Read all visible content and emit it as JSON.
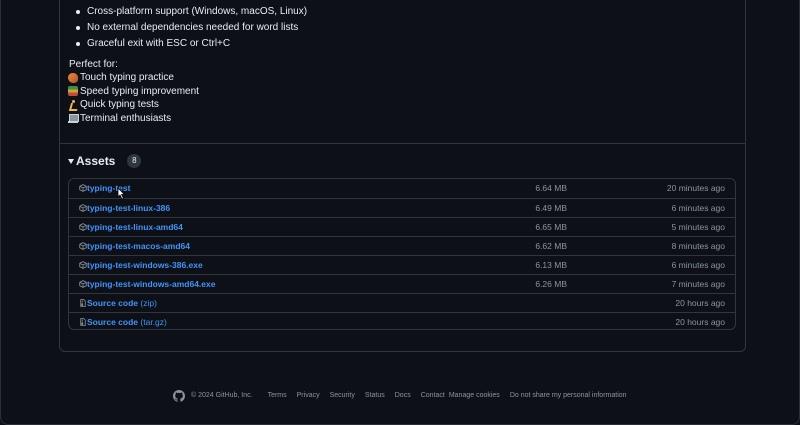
{
  "release": {
    "features": [
      "Cross-platform support (Windows, macOS, Linux)",
      "No external dependencies needed for word lists",
      "Graceful exit with ESC or Ctrl+C"
    ],
    "perfect_for_title": "Perfect for:",
    "perfect_for": [
      {
        "icon": "guitar-icon",
        "label": "Touch typing practice"
      },
      {
        "icon": "books-icon",
        "label": "Speed typing improvement"
      },
      {
        "icon": "runner-icon",
        "label": "Quick typing tests"
      },
      {
        "icon": "laptop-icon",
        "label": "Terminal enthusiasts"
      }
    ]
  },
  "assets": {
    "title": "Assets",
    "count": "8",
    "items": [
      {
        "name": "typing-test",
        "suffix": "",
        "size": "6.64 MB",
        "time": "20 minutes ago",
        "icon": "package-icon"
      },
      {
        "name": "typing-test-linux-386",
        "suffix": "",
        "size": "6.49 MB",
        "time": "6 minutes ago",
        "icon": "package-icon"
      },
      {
        "name": "typing-test-linux-amd64",
        "suffix": "",
        "size": "6.65 MB",
        "time": "5 minutes ago",
        "icon": "package-icon"
      },
      {
        "name": "typing-test-macos-amd64",
        "suffix": "",
        "size": "6.62 MB",
        "time": "8 minutes ago",
        "icon": "package-icon"
      },
      {
        "name": "typing-test-windows-386.exe",
        "suffix": "",
        "size": "6.13 MB",
        "time": "6 minutes ago",
        "icon": "package-icon"
      },
      {
        "name": "typing-test-windows-amd64.exe",
        "suffix": "",
        "size": "6.26 MB",
        "time": "7 minutes ago",
        "icon": "package-icon"
      },
      {
        "name": "Source code",
        "suffix": "(zip)",
        "size": "",
        "time": "20 hours ago",
        "icon": "file-zip-icon"
      },
      {
        "name": "Source code",
        "suffix": "(tar.gz)",
        "size": "",
        "time": "20 hours ago",
        "icon": "file-zip-icon"
      }
    ]
  },
  "footer": {
    "copyright": "© 2024 GitHub, Inc.",
    "links": [
      "Terms",
      "Privacy",
      "Security",
      "Status",
      "Docs",
      "Contact",
      "Manage cookies",
      "Do not share my personal information"
    ]
  },
  "colors": {
    "background": "#0d1117",
    "link": "#4493f8",
    "muted": "#8b949e",
    "border": "#30363d"
  }
}
